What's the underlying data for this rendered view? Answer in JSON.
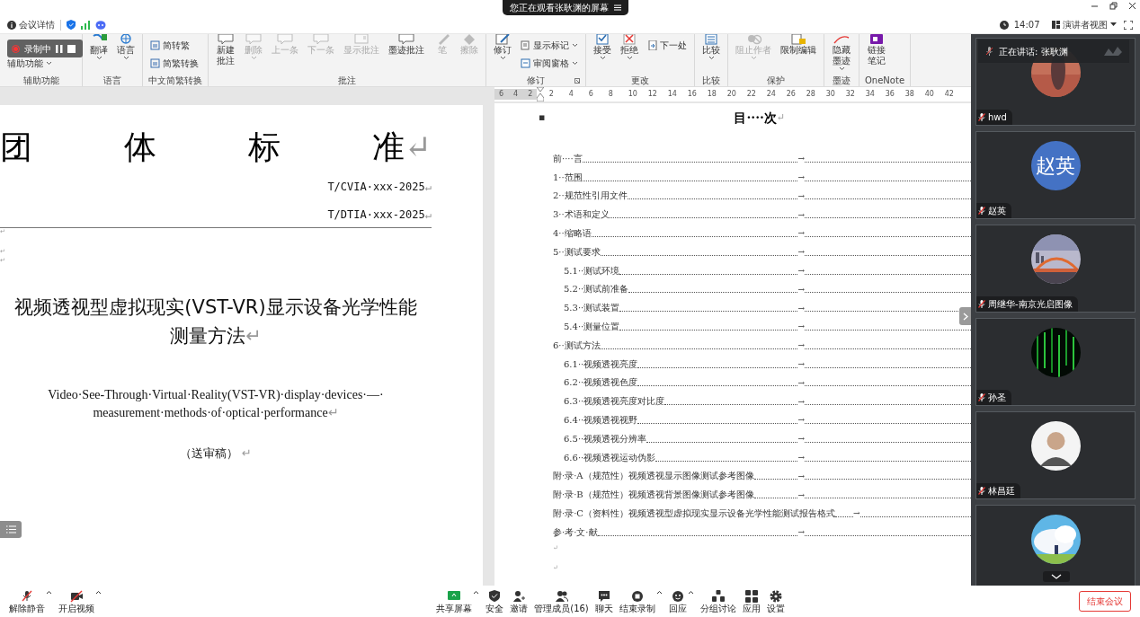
{
  "banner": {
    "text": "您正在观看张耿渊的屏幕"
  },
  "meeting_bar": {
    "details": "会议详情",
    "time": "14:07",
    "view": "演讲者视图"
  },
  "recording": {
    "label": "录制中"
  },
  "ribbon": {
    "groups": [
      {
        "label": "辅助功能",
        "items": [
          {
            "label": "辅助功能",
            "kind": "small",
            "dropdown": true,
            "disabled": false
          }
        ]
      },
      {
        "label": "语言",
        "items": [
          {
            "label": "翻译",
            "kind": "large",
            "dropdown": true,
            "disabled": false
          },
          {
            "label": "语言",
            "kind": "large",
            "dropdown": true,
            "disabled": false
          }
        ]
      },
      {
        "label": "中文简繁转换",
        "items": [
          {
            "label": "简转繁",
            "kind": "small",
            "dropdown": false,
            "disabled": false
          },
          {
            "label": "简繁转换",
            "kind": "small",
            "dropdown": false,
            "disabled": false
          }
        ]
      },
      {
        "label": "批注",
        "items": [
          {
            "label": "新建批注",
            "kind": "large",
            "wrap": true,
            "dropdown": false,
            "disabled": false
          },
          {
            "label": "删除",
            "kind": "large",
            "dropdown": true,
            "disabled": true
          },
          {
            "label": "上一条",
            "kind": "large",
            "dropdown": false,
            "disabled": true
          },
          {
            "label": "下一条",
            "kind": "large",
            "dropdown": false,
            "disabled": true
          },
          {
            "label": "显示批注",
            "kind": "large",
            "dropdown": false,
            "disabled": true
          },
          {
            "label": "墨迹批注",
            "kind": "large",
            "dropdown": false,
            "disabled": false
          },
          {
            "label": "笔",
            "kind": "large",
            "dropdown": false,
            "disabled": true
          },
          {
            "label": "擦除",
            "kind": "large",
            "dropdown": false,
            "disabled": true
          }
        ]
      },
      {
        "label": "修订",
        "launcher": true,
        "items": [
          {
            "label": "修订",
            "kind": "large",
            "dropdown": true,
            "disabled": false
          },
          {
            "label": "显示标记",
            "kind": "small",
            "dropdown": true,
            "disabled": false
          },
          {
            "label": "审阅窗格",
            "kind": "small",
            "dropdown": true,
            "disabled": false
          }
        ]
      },
      {
        "label": "更改",
        "items": [
          {
            "label": "接受",
            "kind": "large",
            "dropdown": true,
            "disabled": false
          },
          {
            "label": "拒绝",
            "kind": "large",
            "dropdown": true,
            "disabled": false
          },
          {
            "label": "下一处",
            "kind": "small",
            "dropdown": false,
            "disabled": false
          }
        ]
      },
      {
        "label": "比较",
        "items": [
          {
            "label": "比较",
            "kind": "large",
            "dropdown": true,
            "disabled": false
          }
        ]
      },
      {
        "label": "保护",
        "items": [
          {
            "label": "阻止作者",
            "kind": "large",
            "dropdown": true,
            "disabled": true
          },
          {
            "label": "限制编辑",
            "kind": "large",
            "dropdown": false,
            "disabled": false
          }
        ]
      },
      {
        "label": "墨迹",
        "items": [
          {
            "label": "隐藏墨迹",
            "kind": "large",
            "wrap": true,
            "dropdown": true,
            "disabled": false
          }
        ]
      },
      {
        "label": "OneNote",
        "items": [
          {
            "label": "链接笔记",
            "kind": "large",
            "wrap": true,
            "dropdown": false,
            "disabled": false
          }
        ]
      }
    ]
  },
  "ruler": {
    "left_labels": [
      "6",
      "4",
      "2"
    ],
    "labels": [
      "2",
      "4",
      "6",
      "8",
      "10",
      "12",
      "14",
      "16",
      "18",
      "20",
      "22",
      "24",
      "26",
      "28",
      "30",
      "32",
      "34",
      "36",
      "38",
      "40",
      "42"
    ]
  },
  "cover_page": {
    "heading": [
      "团",
      "体",
      "标",
      "准"
    ],
    "heading_mark": "↵",
    "codes": [
      {
        "text": "T/CVIA·xxx-2025",
        "mark": "↵"
      },
      {
        "text": "T/DTIA·xxx-2025",
        "mark": "↵"
      }
    ],
    "empty_marks": [
      "↵",
      "↵",
      "↵"
    ],
    "title": {
      "lines": [
        "视频透视型虚拟现实(VST-VR)显示设备光学性能",
        "测量方法"
      ],
      "mark": "↵"
    },
    "subtitle": {
      "lines": [
        "Video·See-Through·Virtual·Reality(VST-VR)·display·devices·—·",
        "measurement·methods·of·optical·performance"
      ],
      "mark": "↵"
    },
    "stage": {
      "text": "（送审稿）",
      "mark": "↵"
    }
  },
  "toc_page": {
    "bullet": "▪",
    "title": "目····次",
    "title_mark": "↵",
    "tab": "→",
    "entries": [
      {
        "label": "前····言"
      },
      {
        "label": "1··范围"
      },
      {
        "label": "2··规范性引用文件"
      },
      {
        "label": "3··术语和定义"
      },
      {
        "label": "4··缩略语"
      },
      {
        "label": "5··测试要求",
        "children": [
          {
            "label": "5.1··测试环境"
          },
          {
            "label": "5.2··测试前准备"
          },
          {
            "label": "5.3··测试装置"
          },
          {
            "label": "5.4··测量位置"
          }
        ]
      },
      {
        "label": "6··测试方法",
        "children": [
          {
            "label": "6.1··视频透视亮度"
          },
          {
            "label": "6.2··视频透视色度"
          },
          {
            "label": "6.3··视频透视亮度对比度"
          },
          {
            "label": "6.4··视频透视视野"
          },
          {
            "label": "6.5··视频透视分辨率"
          },
          {
            "label": "6.6··视频透视运动伪影"
          }
        ]
      },
      {
        "label": "附·录·A（规范性）视频透视显示图像测试参考图像"
      },
      {
        "label": "附·录·B（规范性）视频透视背景图像测试参考图像"
      },
      {
        "label": "附·录·C（资料性）视频透视型虚拟现实显示设备光学性能测试报告格式"
      },
      {
        "label": "参·考·文·献"
      }
    ],
    "end_marks": [
      "↵",
      "↵"
    ]
  },
  "speaker": {
    "text": "正在讲话:  张耿渊"
  },
  "participants": [
    {
      "name": "hwd",
      "muted": true,
      "avatar": {
        "kind": "picture"
      }
    },
    {
      "name": "赵英",
      "muted": true,
      "avatar": {
        "kind": "initials",
        "text": "赵英",
        "color": "#4472c4"
      }
    },
    {
      "name": "周继华-南京光启图像",
      "muted": true,
      "avatar": {
        "kind": "picture"
      }
    },
    {
      "name": "孙圣",
      "muted": true,
      "avatar": {
        "kind": "picture"
      }
    },
    {
      "name": "林昌廷",
      "muted": true,
      "avatar": {
        "kind": "person"
      }
    },
    {
      "avatar": {
        "kind": "picture"
      }
    }
  ],
  "toolbar": {
    "left": [
      {
        "label": "解除静音",
        "menu": true
      },
      {
        "label": "开启视频",
        "menu": true
      }
    ],
    "center": [
      {
        "label": "共享屏幕",
        "menu": true
      },
      {
        "label": "安全",
        "menu": false
      },
      {
        "label": "邀请",
        "menu": false
      },
      {
        "label": "管理成员(16)",
        "menu": false
      },
      {
        "label": "聊天",
        "menu": false
      },
      {
        "label": "结束录制",
        "menu": true
      },
      {
        "label": "回应",
        "menu": true
      },
      {
        "label": "分组讨论",
        "menu": false
      },
      {
        "label": "应用",
        "menu": false
      },
      {
        "label": "设置",
        "menu": false
      }
    ],
    "end_button": "结束会议"
  }
}
